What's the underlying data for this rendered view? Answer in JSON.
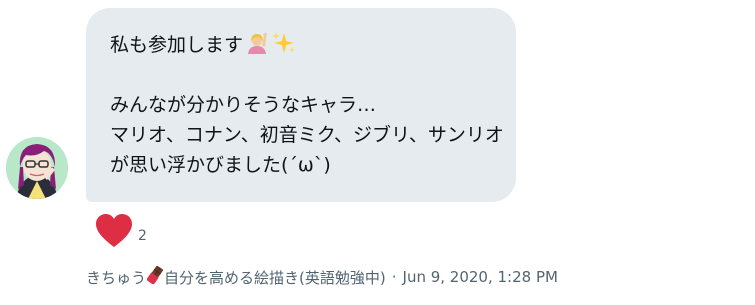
{
  "message": {
    "lines": [
      "私も参加します",
      "",
      "みんなが分かりそうなキャラ…",
      "マリオ、コナン、初音ミク、ジブリ、サンリオ",
      "が思い浮かびました(´ω`)"
    ],
    "emojis": [
      "raising-hand-emoji",
      "sparkles-emoji"
    ]
  },
  "reaction": {
    "icon": "heart-icon",
    "count": "2",
    "color": "#e0245e"
  },
  "meta": {
    "sender_prefix": "きちゅう",
    "sender_icon": "chocolate-bar-icon",
    "sender_suffix": "自分を高める絵描き(英語勉強中)",
    "separator": "·",
    "timestamp": "Jun 9, 2020, 1:28 PM"
  },
  "colors": {
    "bubble_bg": "#e6ebf0",
    "text": "#0f1419",
    "meta_text": "#536471"
  }
}
